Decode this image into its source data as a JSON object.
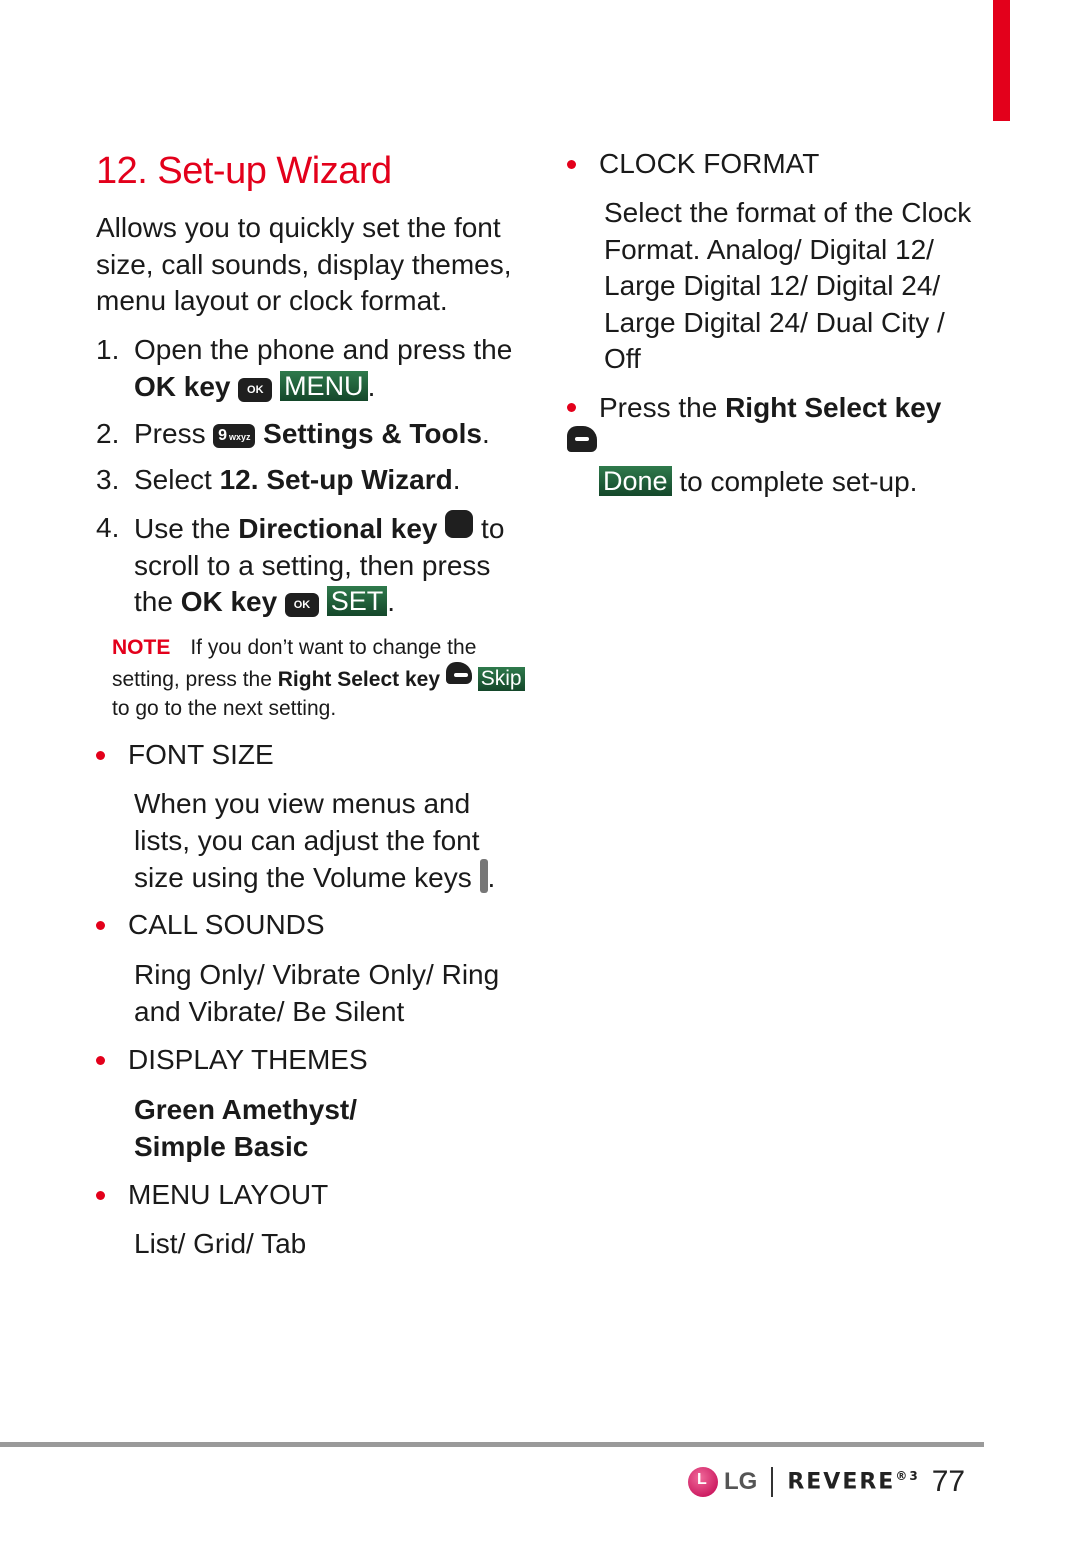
{
  "colors": {
    "accent": "#e3001b",
    "softkey_green": "#1f5e38",
    "rule_gray": "#9a9a9a"
  },
  "title": "12. Set-up Wizard",
  "intro": "Allows you to quickly set the font size, call sounds, display themes, menu layout or clock format.",
  "steps": [
    {
      "num": "1.",
      "text_a": "Open the phone and press the ",
      "bold_a": "OK key",
      "icon": "ok-key-icon",
      "icon_text": "OK",
      "softkey": "MENU",
      "end": "."
    },
    {
      "num": "2.",
      "text_a": "Press ",
      "icon": "nine-key-icon",
      "icon_big": "9",
      "icon_small": "wxyz",
      "bold_a": "Settings & Tools",
      "end": "."
    },
    {
      "num": "3.",
      "text_a": "Select ",
      "bold_a": "12. Set-up Wizard",
      "end": "."
    },
    {
      "num": "4.",
      "text_a": "Use the ",
      "bold_a": "Directional key",
      "icon": "directional-key-icon",
      "text_b": " to scroll to a setting, then press the ",
      "bold_b": "OK key",
      "icon2": "ok-key-icon",
      "icon2_text": "OK",
      "softkey": "SET",
      "end": "."
    }
  ],
  "note": {
    "label": "NOTE",
    "text_a": "If you don’t want to change the setting, press the ",
    "bold": "Right Select key",
    "softkey": "Skip",
    "text_b": " to go to the next setting."
  },
  "options": [
    {
      "heading": "FONT SIZE",
      "body_a": "When you view menus and lists, you can adjust the font size using the Volume keys ",
      "body_end": "."
    },
    {
      "heading": "CALL SOUNDS",
      "body_a": "Ring Only/ Vibrate Only/ Ring and Vibrate/ Be Silent"
    },
    {
      "heading": "DISPLAY THEMES",
      "body_line1": "Green Amethyst/",
      "body_line2": "Simple Basic"
    },
    {
      "heading": "MENU LAYOUT",
      "body_a": "List/ Grid/ Tab"
    },
    {
      "heading": "CLOCK FORMAT",
      "body_a": "Select the format of the Clock Format. Analog/ Digital 12/ Large Digital 12/ Digital 24/ Large Digital 24/ Dual City / Off"
    }
  ],
  "final_step": {
    "text_a": "Press the ",
    "bold": "Right Select key",
    "softkey": "Done",
    "text_b": " to complete set-up."
  },
  "footer": {
    "brand": "LG",
    "product": "REVERE",
    "product_sup": "®3",
    "page_number": "77"
  }
}
